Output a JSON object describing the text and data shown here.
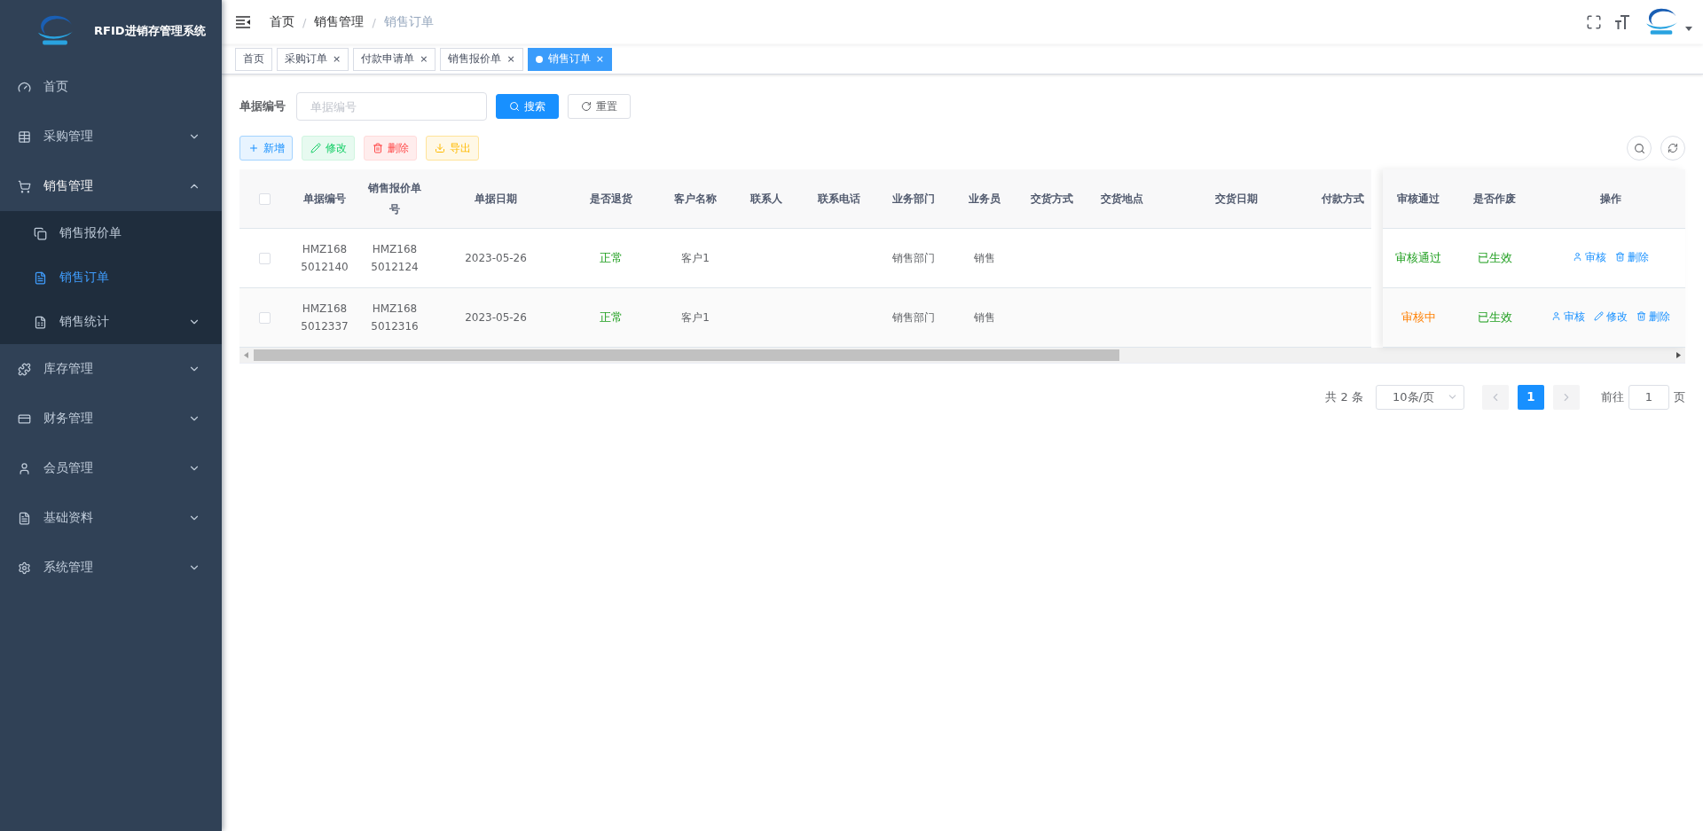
{
  "sidebar": {
    "title": "RFID进销存管理系统",
    "items": [
      {
        "label": "首页",
        "selected": false
      },
      {
        "label": "采购管理",
        "selected": false,
        "expanded": false
      },
      {
        "label": "销售管理",
        "selected": false,
        "expanded": true,
        "children": [
          {
            "label": "销售报价单",
            "selected": false
          },
          {
            "label": "销售订单",
            "selected": true
          },
          {
            "label": "销售统计",
            "selected": false,
            "expanded": false
          }
        ]
      },
      {
        "label": "库存管理",
        "selected": false,
        "expanded": false
      },
      {
        "label": "财务管理",
        "selected": false,
        "expanded": false
      },
      {
        "label": "会员管理",
        "selected": false,
        "expanded": false
      },
      {
        "label": "基础资料",
        "selected": false,
        "expanded": false
      },
      {
        "label": "系统管理",
        "selected": false,
        "expanded": false
      }
    ]
  },
  "breadcrumb": [
    {
      "label": "首页"
    },
    {
      "separator": "/",
      "label": "销售管理"
    },
    {
      "separator": "/",
      "label": "销售订单"
    }
  ],
  "tabs": [
    {
      "label": "首页",
      "selected": false
    },
    {
      "label": "采购订单",
      "selected": false,
      "close": "×"
    },
    {
      "label": "付款申请单",
      "selected": false,
      "close": "×"
    },
    {
      "label": "销售报价单",
      "selected": false,
      "close": "×"
    },
    {
      "label": "销售订单",
      "selected": true,
      "close": "×"
    }
  ],
  "search": {
    "label": "单据编号",
    "placeholder": "单据编号",
    "buttons": [
      {
        "label": "搜索",
        "kind": "search"
      },
      {
        "label": "重置",
        "kind": "reset"
      }
    ]
  },
  "toolbar": [
    {
      "label": "新增",
      "kind": "add"
    },
    {
      "label": "修改",
      "kind": "edit"
    },
    {
      "label": "删除",
      "kind": "delete"
    },
    {
      "label": "导出",
      "kind": "export"
    }
  ],
  "table": {
    "header_checked": false,
    "columns": [
      "单据编号",
      "销售报价单号",
      "单据日期",
      "是否退货",
      "客户名称",
      "联系人",
      "联系电话",
      "业务部门",
      "业务员",
      "交货方式",
      "交货地点",
      "交货日期",
      "付款方式"
    ],
    "fixed_columns": [
      "审核通过",
      "是否作废",
      "操作"
    ],
    "rows": [
      {
        "checked": false,
        "cells": [
          "HMZ1685012140",
          "HMZ1685012124",
          "2023-05-26",
          "正常",
          "客户1",
          "",
          "",
          "销售部门",
          "销售",
          "",
          "",
          "",
          ""
        ],
        "audit": {
          "text": "审核通过",
          "kind": "approved"
        },
        "void": {
          "text": "已生效",
          "kind": "effective"
        },
        "actions": [
          {
            "label": "审核",
            "kind": "audit"
          },
          {
            "label": "删除",
            "kind": "delete"
          }
        ]
      },
      {
        "checked": false,
        "cells": [
          "HMZ1685012337",
          "HMZ1685012316",
          "2023-05-26",
          "正常",
          "客户1",
          "",
          "",
          "销售部门",
          "销售",
          "",
          "",
          "",
          ""
        ],
        "audit": {
          "text": "审核中",
          "kind": "pending"
        },
        "void": {
          "text": "已生效",
          "kind": "effective"
        },
        "actions": [
          {
            "label": "审核",
            "kind": "audit"
          },
          {
            "label": "修改",
            "kind": "edit"
          },
          {
            "label": "删除",
            "kind": "delete"
          }
        ]
      }
    ]
  },
  "pagination": {
    "total": "共 2 条",
    "page_size": "10条/页",
    "pages": [
      {
        "label": "1",
        "selected": true
      }
    ],
    "goto": "前往",
    "goto_value": "1",
    "page_suffix": "页"
  }
}
